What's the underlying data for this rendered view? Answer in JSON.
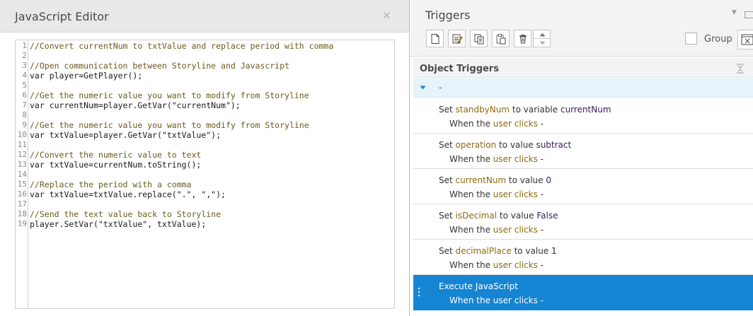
{
  "js_editor": {
    "title": "JavaScript Editor",
    "close_glyph": "✕",
    "code_lines": [
      {
        "num": "1",
        "text": "//Convert currentNum to txtValue and replace period with comma",
        "comment": true
      },
      {
        "num": "2",
        "text": "",
        "comment": false
      },
      {
        "num": "3",
        "text": "//Open communication between Storyline and Javascript",
        "comment": true
      },
      {
        "num": "4",
        "text": "var player=GetPlayer();",
        "comment": false
      },
      {
        "num": "5",
        "text": "",
        "comment": false
      },
      {
        "num": "6",
        "text": "//Get the numeric value you want to modify from Storyline",
        "comment": true
      },
      {
        "num": "7",
        "text": "var currentNum=player.GetVar(\"currentNum\");",
        "comment": false
      },
      {
        "num": "8",
        "text": "",
        "comment": false
      },
      {
        "num": "9",
        "text": "//Get the numeric value you want to modify from Storyline",
        "comment": true
      },
      {
        "num": "10",
        "text": "var txtValue=player.GetVar(\"txtValue\");",
        "comment": false
      },
      {
        "num": "11",
        "text": "",
        "comment": false
      },
      {
        "num": "12",
        "text": "//Convert the numeric value to text",
        "comment": true
      },
      {
        "num": "13",
        "text": "var txtValue=currentNum.toString();",
        "comment": false
      },
      {
        "num": "14",
        "text": "",
        "comment": false
      },
      {
        "num": "15",
        "text": "//Replace the period with a comma",
        "comment": true
      },
      {
        "num": "16",
        "text": "var txtValue=txtValue.replace(\".\", \",\");",
        "comment": false
      },
      {
        "num": "17",
        "text": "",
        "comment": false
      },
      {
        "num": "18",
        "text": "//Send the text value back to Storyline",
        "comment": true
      },
      {
        "num": "19",
        "text": "player.SetVar(\"txtValue\", txtValue);",
        "comment": false
      }
    ]
  },
  "triggers_panel": {
    "title": "Triggers",
    "menu_glyph": "▼",
    "toolbar": {
      "icons": [
        "new-trigger-icon",
        "edit-trigger-icon",
        "copy-icon",
        "paste-icon",
        "delete-icon"
      ],
      "move_up_icon": "move-up-icon",
      "move_down_icon": "move-down-icon"
    },
    "group_label": "Group",
    "section_title": "Object Triggers",
    "group_name": "-",
    "triggers": [
      {
        "pre": "Set ",
        "var": "standbyNum",
        "mid": " to variable ",
        "val": "currentNum",
        "when_pre": "When the ",
        "when_kw": "user clicks",
        "when_post": " -",
        "selected": false
      },
      {
        "pre": "Set ",
        "var": "operation",
        "mid": " to value ",
        "val": "subtract",
        "when_pre": "When the ",
        "when_kw": "user clicks",
        "when_post": " -",
        "selected": false
      },
      {
        "pre": "Set ",
        "var": "currentNum",
        "mid": " to value ",
        "val": "0",
        "when_pre": "When the ",
        "when_kw": "user clicks",
        "when_post": " -",
        "selected": false
      },
      {
        "pre": "Set ",
        "var": "isDecimal",
        "mid": " to value ",
        "val": "False",
        "when_pre": "When the ",
        "when_kw": "user clicks",
        "when_post": " -",
        "selected": false
      },
      {
        "pre": "Set ",
        "var": "decimalPlace",
        "mid": " to value ",
        "val": "1",
        "when_pre": "When the ",
        "when_kw": "user clicks",
        "when_post": " -",
        "selected": false
      },
      {
        "pre": "Execute JavaScript",
        "var": "",
        "mid": "",
        "val": "",
        "when_pre": "When the ",
        "when_kw": "user clicks",
        "when_post": " -",
        "selected": true
      }
    ]
  },
  "colors": {
    "selected_row": "#1585d3",
    "keyword": "#8b6a0c",
    "comment": "#6b5a1c"
  }
}
